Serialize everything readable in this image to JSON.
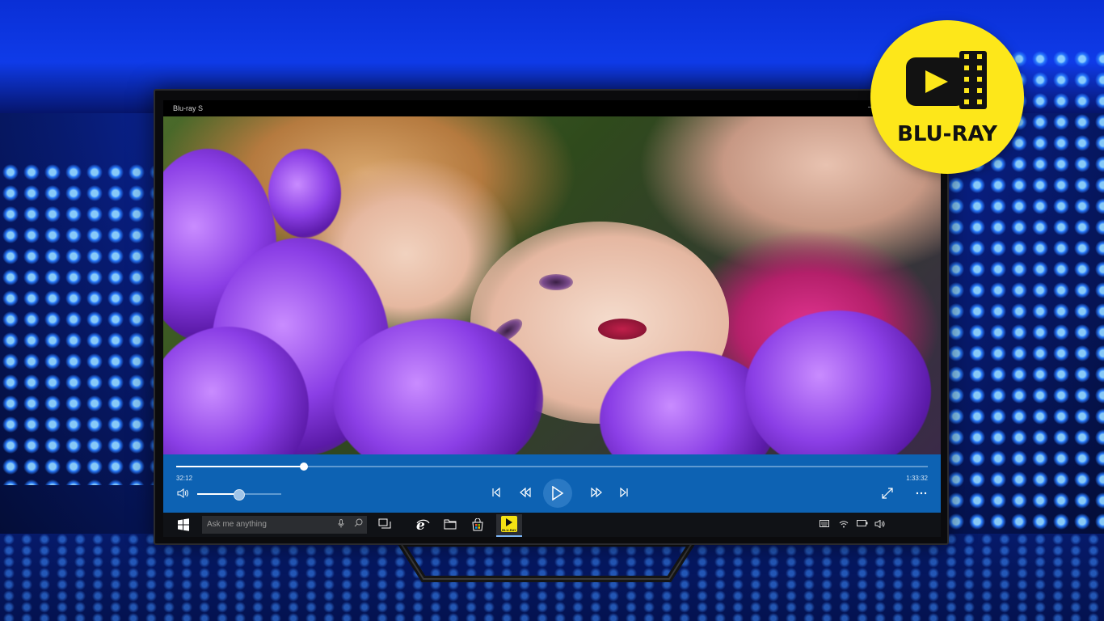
{
  "window": {
    "title": "Blu-ray S",
    "minimize_label": "—"
  },
  "player": {
    "progress_fraction": 0.17,
    "current_time": "32:12",
    "total_time": "1:33:32",
    "volume_fraction": 0.5,
    "icons": {
      "volume": "speaker-icon",
      "previous": "skip-previous-icon",
      "rewind": "rewind-icon",
      "play": "play-icon",
      "fast_forward": "fast-forward-icon",
      "next": "skip-next-icon",
      "fullscreen": "fullscreen-icon",
      "more": "more-icon"
    }
  },
  "taskbar": {
    "search_placeholder": "Ask me anything",
    "app_badge_text": "BLU-RAY"
  },
  "logo": {
    "text": "BLU-RAY",
    "color": "#fde71a"
  },
  "colors": {
    "control_bar": "#0d62b3",
    "taskbar": "#101216"
  }
}
